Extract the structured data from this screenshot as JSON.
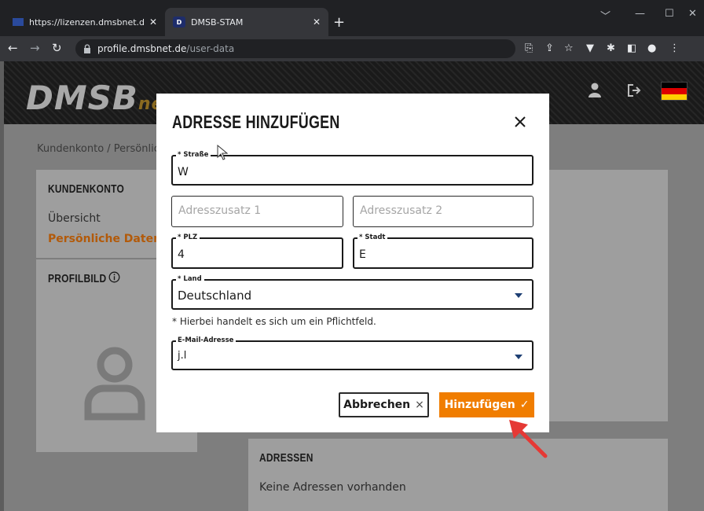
{
  "browser": {
    "tabs": [
      {
        "title": "https://lizenzen.dmsbnet.de/lizen"
      },
      {
        "title": "DMSB-STAM",
        "favicon_text": "D"
      }
    ],
    "new_tab": "+",
    "url_host": "profile.dmsbnet.de",
    "url_path": "/user-data"
  },
  "site": {
    "logo_main": "DMSB",
    "logo_suffix": "net",
    "breadcrumb": "Kundenkonto / Persönlic",
    "flag_colors": [
      "#000000",
      "#dd0000",
      "#ffce00"
    ]
  },
  "sidebar": {
    "title": "KUNDENKONTO",
    "items": [
      {
        "label": "Übersicht",
        "active": false
      },
      {
        "label": "Persönliche Daten",
        "active": true
      }
    ]
  },
  "profile_picture": {
    "title": "PROFILBILD"
  },
  "addresses": {
    "title": "ADRESSEN",
    "empty_text": "Keine Adressen vorhanden"
  },
  "modal": {
    "title": "ADRESSE HINZUFÜGEN",
    "fields": {
      "street": {
        "label": "* Straße",
        "value": "W"
      },
      "addition1": {
        "placeholder": "Adresszusatz 1"
      },
      "addition2": {
        "placeholder": "Adresszusatz 2"
      },
      "zip": {
        "label": "* PLZ",
        "value": "4"
      },
      "city": {
        "label": "* Stadt",
        "value": "E"
      },
      "country": {
        "label": "* Land",
        "value": "Deutschland"
      },
      "email": {
        "label": "E-Mail-Adresse",
        "value": "j.l"
      }
    },
    "required_hint": "* Hierbei handelt es sich um ein Pflichtfeld.",
    "cancel_label": "Abbrechen",
    "cancel_icon": "×",
    "add_label": "Hinzufügen",
    "add_icon": "✓"
  },
  "colors": {
    "accent": "#f07d00",
    "active_link": "#b25a0a",
    "annotation_arrow": "#e53935",
    "overlay": "#7e7e7e"
  }
}
